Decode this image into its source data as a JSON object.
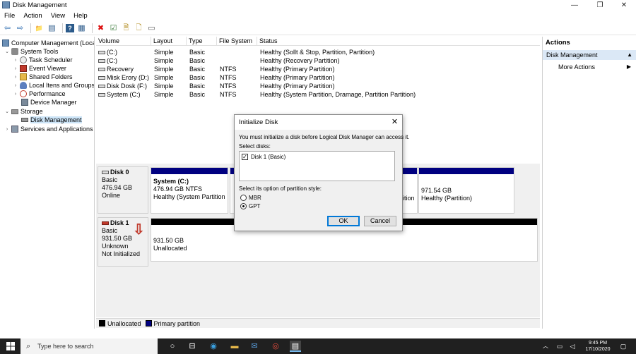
{
  "window": {
    "title": "Disk Management",
    "controls": {
      "minimize": "—",
      "maximize": "❐",
      "close": "✕"
    }
  },
  "menu": {
    "file": "File",
    "action": "Action",
    "view": "View",
    "help": "Help"
  },
  "toolbar": {
    "icons": [
      "back-icon",
      "forward-icon",
      "up-folder-icon",
      "show-hide-tree-icon",
      "help-icon",
      "properties-icon",
      "delete-icon",
      "check-icon",
      "new-icon",
      "open-icon",
      "console-icon"
    ],
    "glyphs": {
      "back": "⇦",
      "forward": "⇨",
      "up": "📁",
      "tree": "▤",
      "help": "?",
      "props": "▦",
      "delete": "✖",
      "check": "☑",
      "new": "🗎",
      "open": "🗋",
      "console": "▭"
    }
  },
  "tree": {
    "root": "Computer Management (Local)",
    "system_tools": "System Tools",
    "task_scheduler": "Task Scheduler",
    "event_viewer": "Event Viewer",
    "shared_folders": "Shared Folders",
    "local_users": "Local Itens and Groups",
    "performance": "Performance",
    "device_manager": "Device Manager",
    "storage": "Storage",
    "disk_management": "Disk Management",
    "services": "Services and Applications"
  },
  "volumes": {
    "columns": {
      "volume": "Volume",
      "layout": "Layout",
      "type": "Type",
      "fs": "File System",
      "status": "Status"
    },
    "rows": [
      {
        "volume": "(C:)",
        "layout": "Simple",
        "type": "Basic",
        "fs": "",
        "status": "Healthy (Sollt & Stop, Partition, Partition)"
      },
      {
        "volume": "(C:)",
        "layout": "Simple",
        "type": "Basic",
        "fs": "",
        "status": "Healthy (Recovery Partition)"
      },
      {
        "volume": "Recovery",
        "layout": "Simple",
        "type": "Basic",
        "fs": "NTFS",
        "status": "Healthy (Primary Partition)"
      },
      {
        "volume": "Misk Erory (D:)",
        "layout": "Simple",
        "type": "Basic",
        "fs": "NTFS",
        "status": "Healthy (Primary Partition)"
      },
      {
        "volume": "Disk Dosk (F:)",
        "layout": "Simple",
        "type": "Basic",
        "fs": "NTFS",
        "status": "Healthy (Primary Partition)"
      },
      {
        "volume": "System (C:)",
        "layout": "Simple",
        "type": "Basic",
        "fs": "NTFS",
        "status": "Healthy (System Partition, Dramage, Partition Partition)"
      }
    ]
  },
  "disks": {
    "disk0": {
      "name": "Disk 0",
      "type": "Basic",
      "size": "476.94 GB",
      "state": "Online",
      "p1_name": "System  (C:)",
      "p1_size": "476.94 GB NTFS",
      "p1_status": "Healthy (System Partition",
      "p_mid_status": "ition",
      "p_last_size": "971.54 GB",
      "p_last_status": "Healthy (Partition)"
    },
    "disk1": {
      "name": "Disk 1",
      "type": "Basic",
      "size": "931.50 GB",
      "state1": "Unknown",
      "state2": "Not Initialized",
      "unalloc_size": "931.50 GB",
      "unalloc_label": "Unallocated"
    },
    "annotation_arrow": "⇩"
  },
  "legend": {
    "unallocated": "Unallocated",
    "primary": "Primary partition"
  },
  "colors": {
    "primary_bar": "#000080",
    "unallocated_bar": "#000000",
    "annotation": "#c0392b",
    "selection": "#cce4f7",
    "taskbar": "#202020",
    "accent": "#0078d7"
  },
  "actions": {
    "header": "Actions",
    "section": "Disk Management",
    "more": "More Actions"
  },
  "dialog": {
    "title": "Initialize Disk",
    "message": "You must initialize a disk before Logical Disk Manager can access it.",
    "select_label": "Select disks:",
    "disk_item": "Disk 1 (Basic)",
    "style_label": "Select its option of partition style:",
    "mbr": "MBR",
    "gpt": "GPT",
    "ok": "OK",
    "cancel": "Cancel"
  },
  "taskbar": {
    "search_placeholder": "Type here to search",
    "time": "9:45 PM",
    "date": "17/10/2020"
  }
}
